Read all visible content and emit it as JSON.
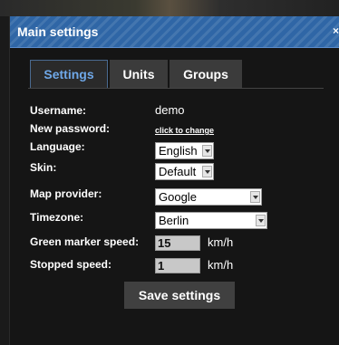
{
  "dialog": {
    "title": "Main settings",
    "close": "×"
  },
  "tabs": [
    {
      "label": "Settings",
      "active": true
    },
    {
      "label": "Units",
      "active": false
    },
    {
      "label": "Groups",
      "active": false
    }
  ],
  "form": {
    "username": {
      "label": "Username:",
      "value": "demo"
    },
    "password": {
      "label": "New password:",
      "link": "click to change"
    },
    "language": {
      "label": "Language:",
      "value": "English"
    },
    "skin": {
      "label": "Skin:",
      "value": "Default"
    },
    "map_provider": {
      "label": "Map provider:",
      "value": "Google"
    },
    "timezone": {
      "label": "Timezone:",
      "value": "Berlin"
    },
    "green_marker_speed": {
      "label": "Green marker speed:",
      "value": "15",
      "unit": "km/h"
    },
    "stopped_speed": {
      "label": "Stopped speed:",
      "value": "1",
      "unit": "km/h"
    }
  },
  "save_label": "Save settings",
  "colors": {
    "titlebar": "#2f66a6",
    "active_tab_text": "#6fa8e8",
    "background": "#151515"
  }
}
